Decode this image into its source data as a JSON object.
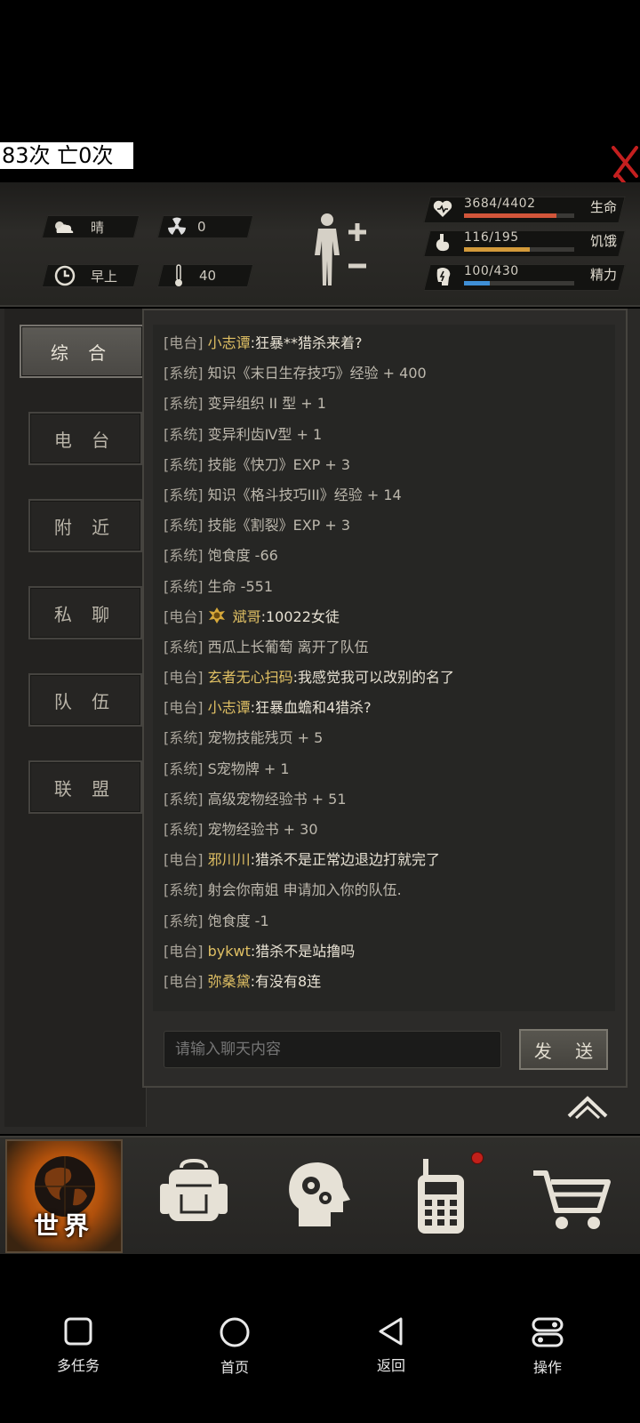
{
  "overlay": {
    "counter_text": "83次 亡0次"
  },
  "status": {
    "weather": "晴",
    "radiation": "0",
    "time_of_day": "早上",
    "temperature": "40",
    "health": {
      "value": "3684/4402",
      "label": "生命",
      "fraction": 0.837,
      "color": "#d2553a"
    },
    "hunger": {
      "value": "116/195",
      "label": "饥饿",
      "fraction": 0.595,
      "color": "#d39a3a"
    },
    "energy": {
      "value": "100/430",
      "label": "精力",
      "fraction": 0.233,
      "color": "#3f8fd6"
    }
  },
  "tabs": [
    "综 合",
    "电 台",
    "附 近",
    "私 聊",
    "队 伍",
    "联 盟"
  ],
  "chat": {
    "messages": [
      {
        "tag": "[电台]",
        "name": "小志谭",
        "text": ":狂暴**猎杀来着?"
      },
      {
        "tag": "[系统]",
        "text": "知识《末日生存技巧》经验 + 400"
      },
      {
        "tag": "[系统]",
        "text": "变异组织 II 型 + 1"
      },
      {
        "tag": "[系统]",
        "text": "变异利齿Ⅳ型 + 1"
      },
      {
        "tag": "[系统]",
        "text": "技能《快刀》EXP + 3"
      },
      {
        "tag": "[系统]",
        "text": "知识《格斗技巧III》经验 + 14"
      },
      {
        "tag": "[系统]",
        "text": "技能《割裂》EXP + 3"
      },
      {
        "tag": "[系统]",
        "text": "饱食度 -66"
      },
      {
        "tag": "[系统]",
        "text": "生命 -551"
      },
      {
        "tag": "[电台]",
        "name": "斌哥",
        "text": ":10022女徒",
        "badge": true
      },
      {
        "tag": "[系统]",
        "text": "西瓜上长葡萄 离开了队伍"
      },
      {
        "tag": "[电台]",
        "name": "玄者无心扫码",
        "text": ":我感觉我可以改别的名了"
      },
      {
        "tag": "[电台]",
        "name": "小志谭",
        "text": ":狂暴血蟾和4猎杀?"
      },
      {
        "tag": "[系统]",
        "text": "宠物技能残页 + 5"
      },
      {
        "tag": "[系统]",
        "text": "S宠物牌 + 1"
      },
      {
        "tag": "[系统]",
        "text": "高级宠物经验书 + 51"
      },
      {
        "tag": "[系统]",
        "text": "宠物经验书 + 30"
      },
      {
        "tag": "[电台]",
        "name": "邪川川",
        "text": ":猎杀不是正常边退边打就完了"
      },
      {
        "tag": "[系统]",
        "text": "射会你南姐 申请加入你的队伍."
      },
      {
        "tag": "[系统]",
        "text": "饱食度 -1"
      },
      {
        "tag": "[电台]",
        "name": "bykwt",
        "text": ":猎杀不是站撸吗"
      },
      {
        "tag": "[电台]",
        "name": "弥桑黛",
        "text": ":有没有8连"
      }
    ],
    "input_placeholder": "请输入聊天内容",
    "send_label": "发 送"
  },
  "game_nav": {
    "world_label": "世界",
    "items": [
      "backpack-icon",
      "skills-head-icon",
      "radio-walkie-icon",
      "shop-cart-icon"
    ]
  },
  "system_nav": {
    "multitask": "多任务",
    "home": "首页",
    "back": "返回",
    "action": "操作"
  }
}
